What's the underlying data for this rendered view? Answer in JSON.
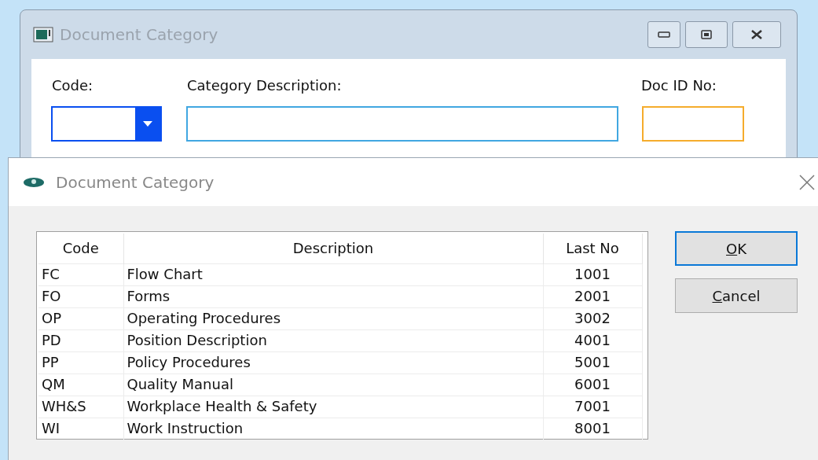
{
  "back_window": {
    "title": "Document Category",
    "fields": [
      {
        "label": "Code:",
        "kind": "combo",
        "color": "#0a4ff0"
      },
      {
        "label": "Category Description:",
        "kind": "text",
        "color": "#41a7e1"
      },
      {
        "label": "Doc ID No:",
        "kind": "text",
        "color": "#f5ac2c"
      }
    ]
  },
  "dialog": {
    "title": "Document Category",
    "table": {
      "columns": [
        "Code",
        "Description",
        "Last No"
      ],
      "rows": [
        [
          "FC",
          "Flow Chart",
          "1001"
        ],
        [
          "FO",
          "Forms",
          "2001"
        ],
        [
          "OP",
          "Operating Procedures",
          "3002"
        ],
        [
          "PD",
          "Position Description",
          "4001"
        ],
        [
          "PP",
          "Policy Procedures",
          "5001"
        ],
        [
          "QM",
          "Quality Manual",
          "6001"
        ],
        [
          "WH&S",
          "Workplace Health & Safety",
          "7001"
        ],
        [
          "WI",
          "Work Instruction",
          "8001"
        ]
      ]
    },
    "buttons": [
      {
        "label": "OK",
        "default": true
      },
      {
        "label": "Cancel",
        "default": false
      }
    ]
  }
}
